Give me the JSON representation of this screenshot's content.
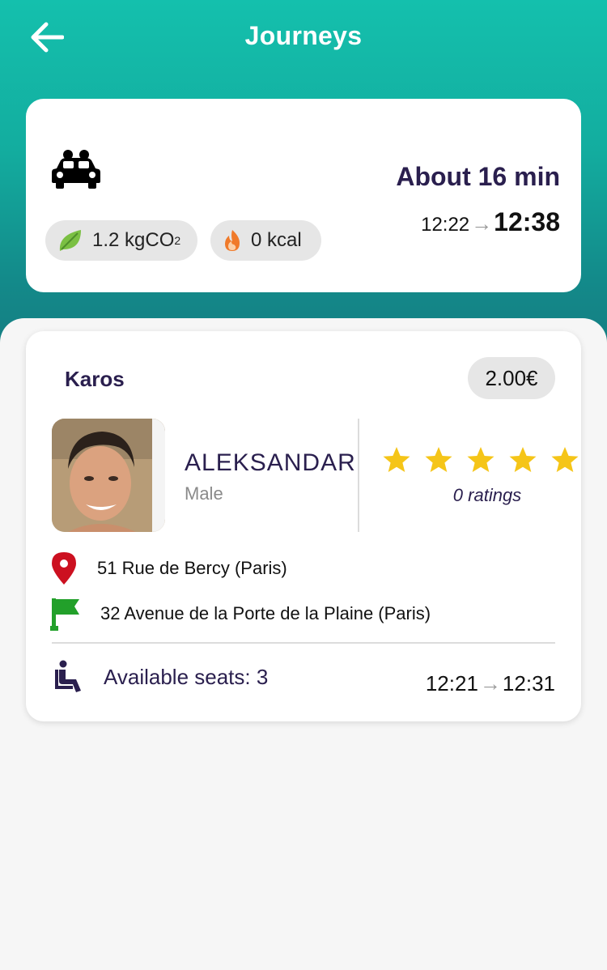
{
  "header": {
    "title": "Journeys",
    "back_icon": "arrow-left-icon"
  },
  "summary": {
    "mode_icon": "carpool-car-icon",
    "duration": "About 16 min",
    "departure": "12:22",
    "arrival": "12:38",
    "co2_value": "1.2 kgCO",
    "co2_subscript": "2",
    "co2_icon": "leaf-icon",
    "kcal": "0 kcal",
    "kcal_icon": "flame-icon"
  },
  "offer": {
    "provider": "Karos",
    "price": "2.00€",
    "driver": {
      "name": "ALEKSANDAR",
      "gender": "Male",
      "avatar": "driver-photo"
    },
    "rating": {
      "stars": 5,
      "label": "0 ratings",
      "star_color": "#f5c518"
    },
    "from": "51 Rue de Bercy (Paris)",
    "to": "32 Avenue de la Porte de la Plaine (Paris)",
    "seats": "Available seats: 3",
    "departure": "12:21",
    "arrival": "12:31"
  },
  "colors": {
    "brand": "#14c0ad",
    "text_dark": "#2a1f4e",
    "pin": "#cc1020",
    "flag": "#22a02a"
  }
}
